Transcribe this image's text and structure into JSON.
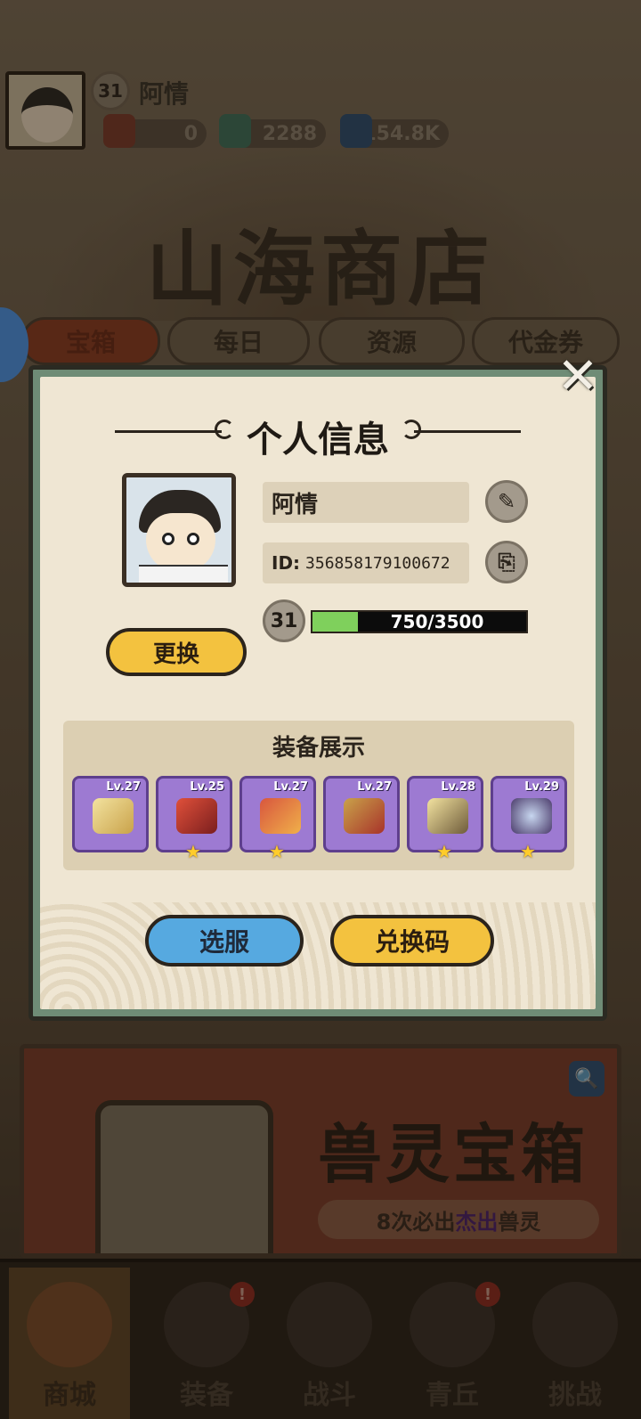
{
  "top": {
    "level": "31",
    "name": "阿情"
  },
  "resources": [
    {
      "icon": "red-ticket-icon",
      "value": "0"
    },
    {
      "icon": "jade-dragon-icon",
      "value": "2288"
    },
    {
      "icon": "blue-crystal-icon",
      "value": "154.8K"
    }
  ],
  "shop_title": "山海商店",
  "tabs": [
    "宝箱",
    "每日",
    "资源",
    "代金券"
  ],
  "banner": {
    "title": "兽灵宝箱",
    "subtitle_prefix": "8次必出",
    "subtitle_highlight": "杰出",
    "subtitle_suffix": "兽灵"
  },
  "nav": [
    {
      "label": "商城",
      "active": true,
      "alert": false
    },
    {
      "label": "装备",
      "active": false,
      "alert": true
    },
    {
      "label": "战斗",
      "active": false,
      "alert": false
    },
    {
      "label": "青丘",
      "active": false,
      "alert": true
    },
    {
      "label": "挑战",
      "active": false,
      "alert": false
    }
  ],
  "modal": {
    "title": "个人信息",
    "close_symbol": "✕",
    "name": "阿情",
    "id_label": "ID:",
    "id_value": "356858179100672",
    "level": "31",
    "xp_text": "750/3500",
    "xp_fraction": 0.214,
    "change_label": "更换",
    "equip_title": "装备展示",
    "equipment": [
      {
        "lv": "Lv.27",
        "icon": "golden-staff-icon",
        "star": false
      },
      {
        "lv": "Lv.25",
        "icon": "red-flower-helmet-icon",
        "star": true
      },
      {
        "lv": "Lv.27",
        "icon": "red-armor-icon",
        "star": true
      },
      {
        "lv": "Lv.27",
        "icon": "red-belt-icon",
        "star": false
      },
      {
        "lv": "Lv.28",
        "icon": "golden-boots-icon",
        "star": true
      },
      {
        "lv": "Lv.29",
        "icon": "jade-amulet-icon",
        "star": true
      }
    ],
    "server_label": "选服",
    "code_label": "兑换码",
    "edit_symbol": "✎",
    "copy_symbol": "⎘"
  },
  "colors": {
    "accent_yellow": "#f3c23f",
    "accent_blue": "#56a9e0",
    "equip_purple": "#9d7ad2",
    "xp_green": "#7fd05c"
  }
}
